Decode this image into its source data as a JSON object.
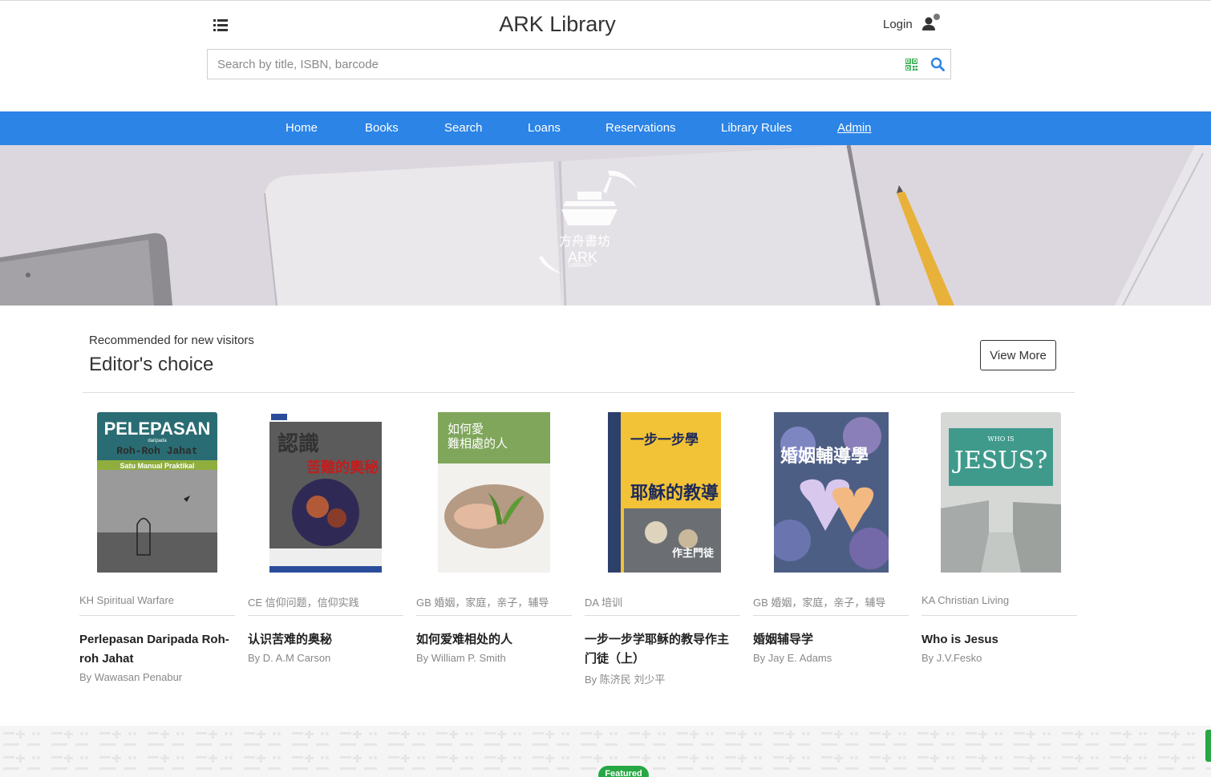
{
  "header": {
    "brand": "ARK Library",
    "login_label": "Login",
    "search_placeholder": "Search by title, ISBN, barcode"
  },
  "nav": {
    "items": [
      "Home",
      "Books",
      "Search",
      "Loans",
      "Reservations",
      "Library Rules",
      "Admin"
    ]
  },
  "banner": {
    "logo_chinese": "方舟書坊",
    "logo_text": "ARK",
    "logo_subtext": "LIBRARY"
  },
  "editors_choice": {
    "subtitle": "Recommended for new visitors",
    "title": "Editor's choice",
    "view_more_label": "View More",
    "books": [
      {
        "category": "KH Spiritual Warfare",
        "title": "Perlepasan Daripada Roh-roh Jahat",
        "author": "By Wawasan Penabur",
        "cover_text": "PELEPASAN",
        "cover_sub": "daripada",
        "cover_line2": "Roh-Roh Jahat",
        "cover_line3": "Satu Manual Praktikal"
      },
      {
        "category": "CE 信仰问题，信仰实践",
        "title": "认识苦难的奥秘",
        "author": "By D. A.M Carson",
        "cover_text": "認識",
        "cover_line2": "苦難的奧秘"
      },
      {
        "category": "GB 婚姻，家庭，亲子，辅导",
        "title": "如何爱难相处的人",
        "author": "By William P. Smith",
        "cover_text": "如何愛",
        "cover_line2": "難相處的人"
      },
      {
        "category": "DA 培训",
        "title": "一步一步学耶稣的教导作主门徒（上）",
        "author": "By 陈济民 刘少平",
        "cover_text": "一步一步學",
        "cover_line2": "耶穌的教導",
        "cover_line3": "作主門徒"
      },
      {
        "category": "GB 婚姻，家庭，亲子，辅导",
        "title": "婚姻辅导学",
        "author": "By Jay E. Adams",
        "cover_text": "婚姻輔導學"
      },
      {
        "category": "KA Christian Living",
        "title": "Who is Jesus",
        "author": "By J.V.Fesko",
        "cover_text": "JESUS?",
        "cover_sub": "WHO IS"
      }
    ]
  },
  "footer": {
    "featured_label": "Featured"
  },
  "colors": {
    "nav_blue": "#2b84e6",
    "accent_green": "#27a844",
    "search_blue": "#2b84e6"
  }
}
